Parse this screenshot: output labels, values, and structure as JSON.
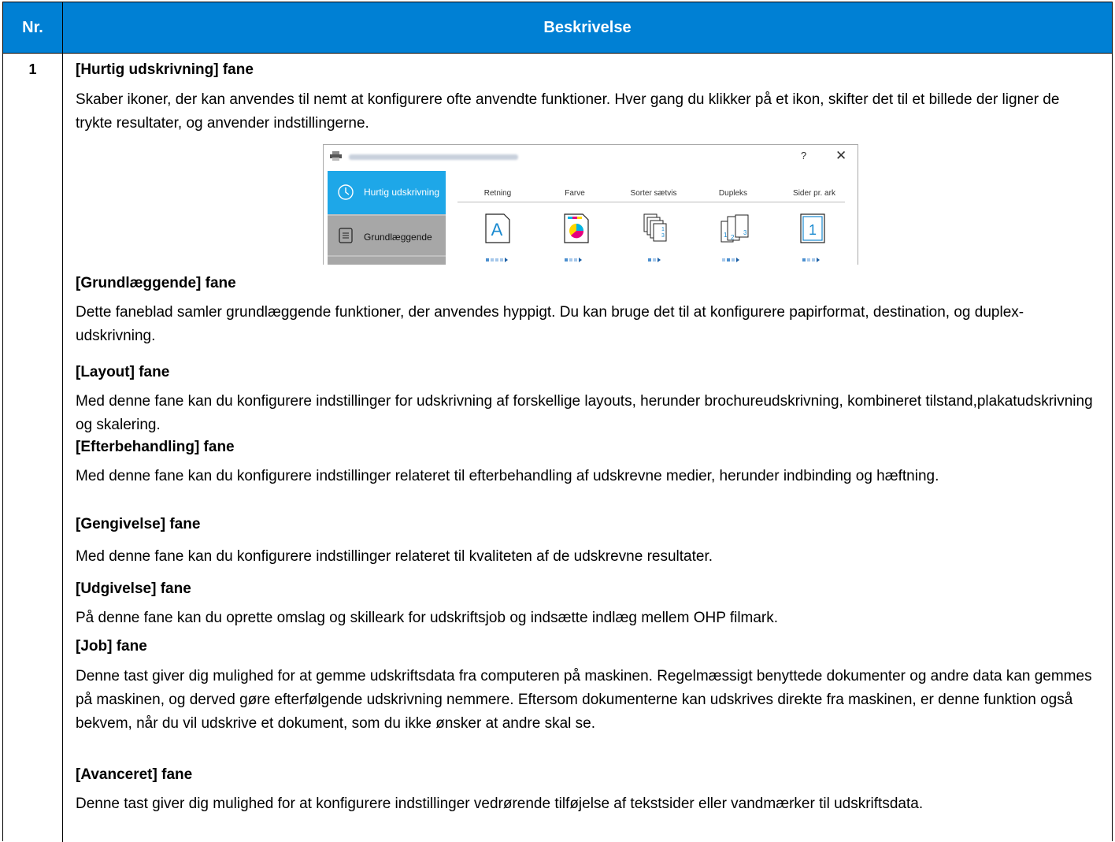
{
  "header": {
    "col_nr": "Nr.",
    "col_desc": "Beskrivelse"
  },
  "row": {
    "number": "1",
    "sections": [
      {
        "title": "[Hurtig udskrivning] fane",
        "text": "Skaber ikoner, der kan anvendes til nemt at konfigurere ofte anvendte funktioner. Hver gang du klikker på et ikon, skifter det til et billede der ligner de trykte resultater, og anvender indstillingerne."
      },
      {
        "title": "[Grundlæggende] fane",
        "text": "Dette faneblad samler grundlæggende funktioner, der anvendes hyppigt. Du kan bruge det til at konfigurere papirformat, destination, og duplex-udskrivning."
      },
      {
        "title": "[Layout] fane",
        "text": "Med denne fane kan du konfigurere indstillinger for udskrivning af forskellige layouts, herunder brochureudskrivning, kombineret tilstand,plakatudskrivning og skalering."
      },
      {
        "title": "[Efterbehandling] fane",
        "text": "Med denne fane kan du konfigurere indstillinger relateret til efterbehandling af udskrevne medier, herunder indbinding og hæftning."
      },
      {
        "title": "[Gengivelse] fane",
        "text": "Med denne fane kan du konfigurere indstillinger relateret til kvaliteten af de udskrevne resultater."
      },
      {
        "title": "[Udgivelse] fane",
        "text": "På denne fane kan du oprette omslag og skilleark for udskriftsjob og indsætte indlæg mellem OHP filmark."
      },
      {
        "title": "[Job] fane",
        "text": "Denne tast giver dig mulighed for at gemme udskriftsdata fra computeren på maskinen. Regelmæssigt benyttede dokumenter og andre data kan gemmes på maskinen, og derved gøre efterfølgende udskrivning nemmere. Eftersom dokumenterne kan udskrives direkte fra maskinen, er denne funktion også bekvem, når du vil udskrive et dokument, som du ikke ønsker at andre skal se."
      },
      {
        "title": "[Avanceret] fane",
        "text": "Denne tast giver dig mulighed for at konfigurere indstillinger vedrørende tilføjelse af tekstsider eller vandmærker til udskriftsdata."
      }
    ]
  },
  "dialog": {
    "help": "?",
    "close": "✕",
    "sidebar": {
      "item1": "Hurtig udskrivning",
      "item2": "Grundlæggende"
    },
    "options": [
      {
        "label": "Retning",
        "icon": "orientation-icon",
        "glyph": "A"
      },
      {
        "label": "Farve",
        "icon": "color-icon"
      },
      {
        "label": "Sorter sætvis",
        "icon": "collate-icon"
      },
      {
        "label": "Dupleks",
        "icon": "duplex-icon"
      },
      {
        "label": "Sider pr. ark",
        "icon": "pages-per-sheet-icon",
        "glyph": "1"
      }
    ],
    "accent": "#1ea7e8"
  }
}
